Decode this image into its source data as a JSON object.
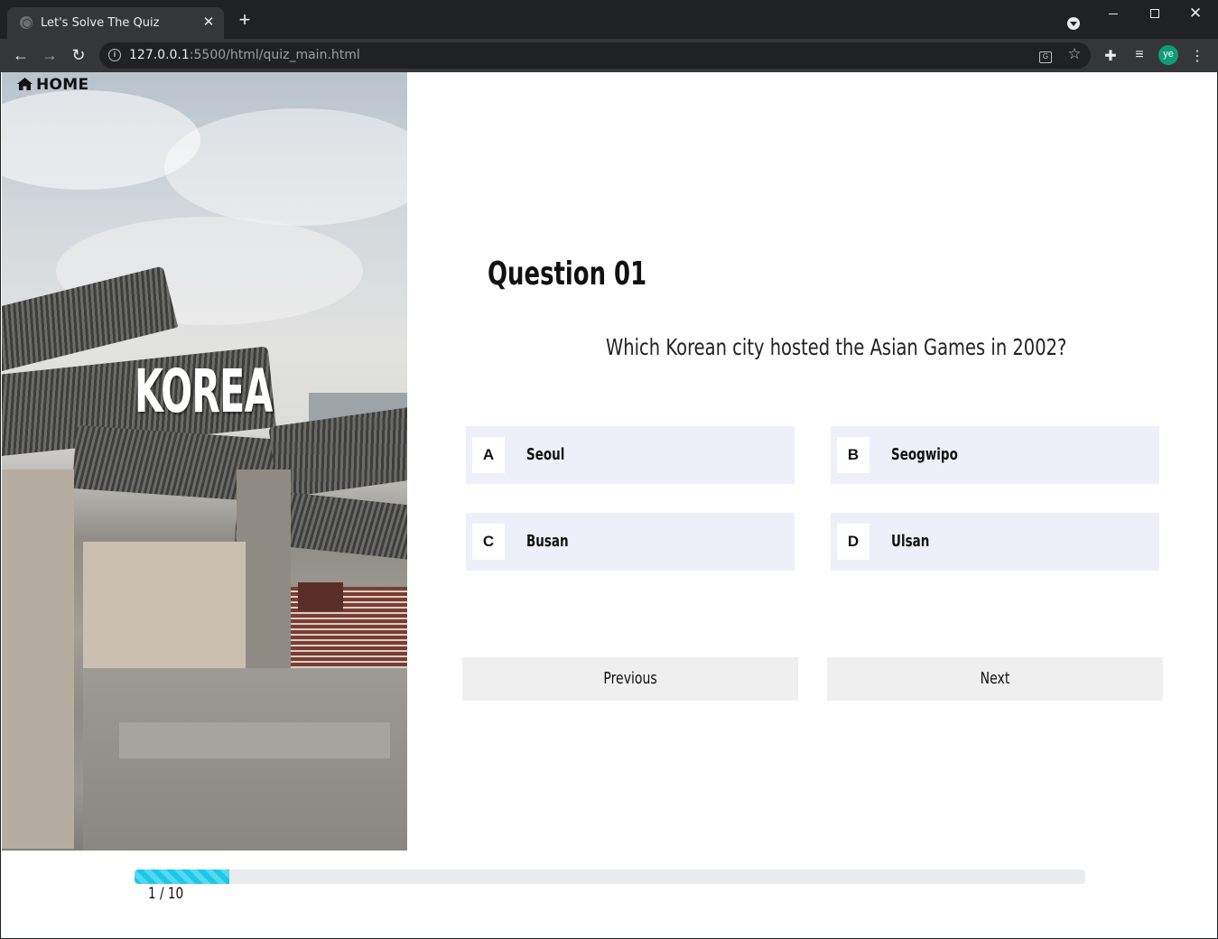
{
  "browser": {
    "tab_title": "Let's Solve The Quiz",
    "url_host": "127.0.0.1",
    "url_rest": ":5500/html/quiz_main.html",
    "profile_initials": "ye"
  },
  "hero": {
    "home_label": "HOME",
    "country": "KOREA"
  },
  "question": {
    "title": "Question 01",
    "text": "Which Korean city hosted the Asian Games in 2002?",
    "options": [
      {
        "letter": "A",
        "label": "Seoul"
      },
      {
        "letter": "B",
        "label": "Seogwipo"
      },
      {
        "letter": "C",
        "label": "Busan"
      },
      {
        "letter": "D",
        "label": "Ulsan"
      }
    ]
  },
  "navigation": {
    "previous_label": "Previous",
    "next_label": "Next"
  },
  "progress": {
    "current": 1,
    "total": 10,
    "label": "1 / 10",
    "fraction": 0.1
  },
  "colors": {
    "option_bg": "#efeff9",
    "progress_fill": "#1cc7ea",
    "avatar": "#0f9d75"
  }
}
